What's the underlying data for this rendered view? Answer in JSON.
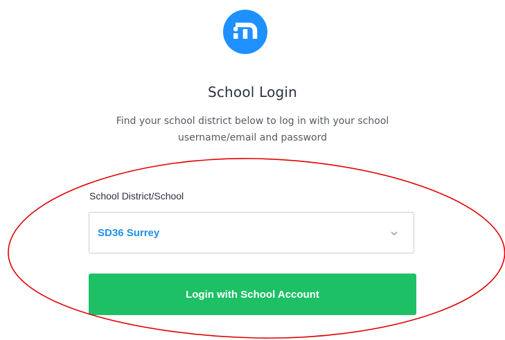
{
  "header": {
    "logo_icon": "mathletics-m-icon",
    "title": "School Login",
    "subtitle": "Find your school district below to log in with your school username/email and password"
  },
  "form": {
    "district_label": "School District/School",
    "district_value": "SD36 Surrey",
    "dropdown_icon": "chevron-down-icon",
    "login_button_label": "Login with School Account"
  },
  "colors": {
    "brand_blue": "#1e90ff",
    "select_text": "#1e90e8",
    "button_green": "#1dc064",
    "annotation_red": "#e00000"
  }
}
